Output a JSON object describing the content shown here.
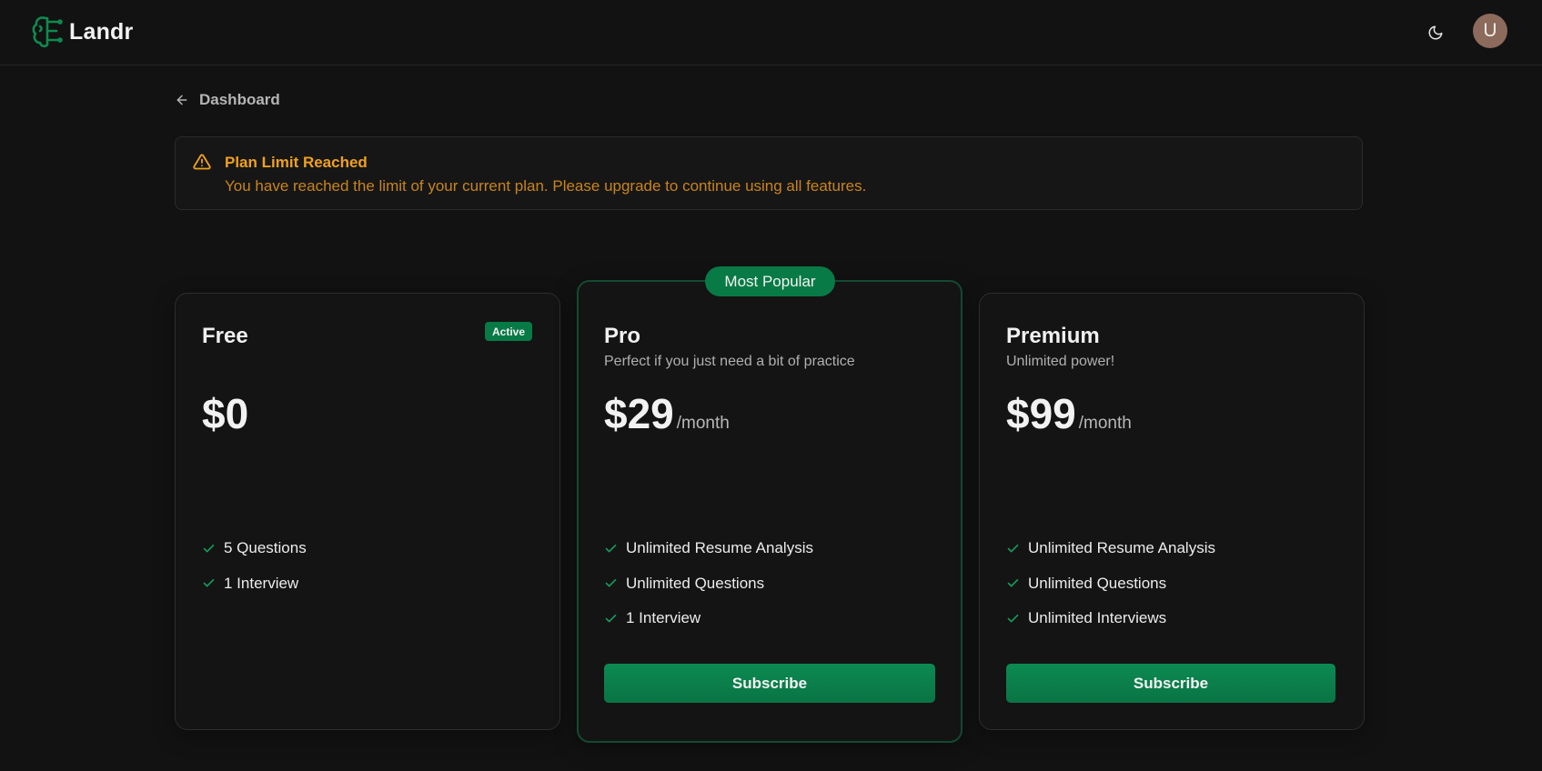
{
  "header": {
    "app_name": "Landr",
    "avatar_initial": "U",
    "theme_icon": "moon-icon",
    "logo_icon": "brain-icon"
  },
  "back_link": {
    "label": "Dashboard",
    "icon": "arrow-left-icon"
  },
  "alert": {
    "icon": "warning-triangle-icon",
    "title": "Plan Limit Reached",
    "message": "You have reached the limit of your current plan. Please upgrade to continue using all features."
  },
  "plans": {
    "free": {
      "name": "Free",
      "badge": "Active",
      "price": "$0",
      "features": [
        "5 Questions",
        "1 Interview"
      ]
    },
    "pro": {
      "badge": "Most Popular",
      "name": "Pro",
      "subtitle": "Perfect if you just need a bit of practice",
      "price": "$29",
      "period": "/month",
      "features": [
        "Unlimited Resume Analysis",
        "Unlimited Questions",
        "1 Interview"
      ],
      "button": "Subscribe"
    },
    "premium": {
      "name": "Premium",
      "subtitle": "Unlimited power!",
      "price": "$99",
      "period": "/month",
      "features": [
        "Unlimited Resume Analysis",
        "Unlimited Questions",
        "Unlimited Interviews"
      ],
      "button": "Subscribe"
    }
  },
  "colors": {
    "background": "#121212",
    "accent_green": "#087a45",
    "warning": "#f0a020",
    "check": "#159a5a"
  }
}
